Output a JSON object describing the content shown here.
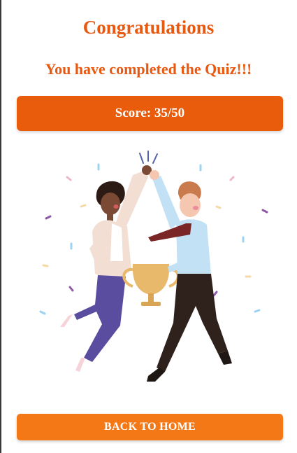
{
  "heading": "Congratulations",
  "message": "You have completed the Quiz!!!",
  "score": {
    "text": "Score: 35/50",
    "value": 35,
    "total": 50
  },
  "illustration": "two-people-high-five-trophy",
  "home_button": {
    "label": "BACK TO HOME"
  },
  "colors": {
    "accent": "#e8580f",
    "score_bg": "#e95c0c",
    "button_bg": "#f57817"
  }
}
